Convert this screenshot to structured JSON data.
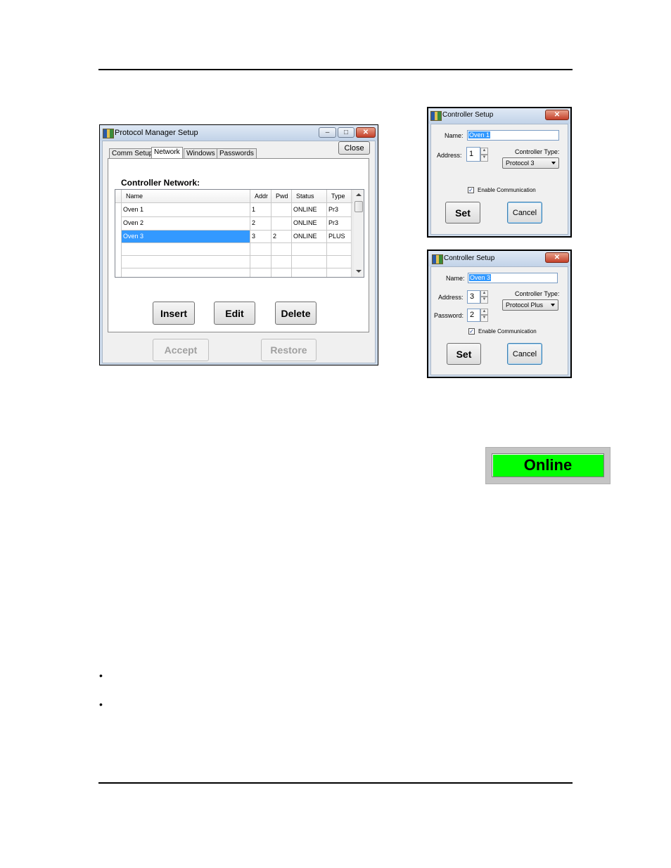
{
  "main_window": {
    "title": "Protocol Manager Setup",
    "close_label": "Close",
    "tabs": [
      "Comm Setup",
      "Network",
      "Windows",
      "Passwords"
    ],
    "heading": "Controller Network:",
    "columns": [
      "Name",
      "Addr",
      "Pwd",
      "Status",
      "Type"
    ],
    "rows": [
      {
        "name": "Oven 1",
        "addr": "1",
        "pwd": "",
        "status": "ONLINE",
        "type": "Pr3"
      },
      {
        "name": "Oven 2",
        "addr": "2",
        "pwd": "",
        "status": "ONLINE",
        "type": "Pr3"
      },
      {
        "name": "Oven 3",
        "addr": "3",
        "pwd": "2",
        "status": "ONLINE",
        "type": "PLUS"
      }
    ],
    "insert_label": "Insert",
    "edit_label": "Edit",
    "delete_label": "Delete",
    "accept_label": "Accept",
    "restore_label": "Restore"
  },
  "dialog1": {
    "title": "Controller Setup",
    "name_label": "Name:",
    "name_value": "Oven 1",
    "address_label": "Address:",
    "address_value": "1",
    "type_label": "Controller Type:",
    "type_value": "Protocol 3",
    "enable_label": "Enable Communication",
    "set_label": "Set",
    "cancel_label": "Cancel"
  },
  "dialog2": {
    "title": "Controller Setup",
    "name_label": "Name:",
    "name_value": "Oven 3",
    "address_label": "Address:",
    "address_value": "3",
    "password_label": "Password:",
    "password_value": "2",
    "type_label": "Controller Type:",
    "type_value": "Protocol Plus",
    "enable_label": "Enable Communication",
    "set_label": "Set",
    "cancel_label": "Cancel"
  },
  "status_indicator": {
    "label": "Online",
    "color": "#00ff00"
  },
  "bullets": [
    "•",
    "•"
  ]
}
